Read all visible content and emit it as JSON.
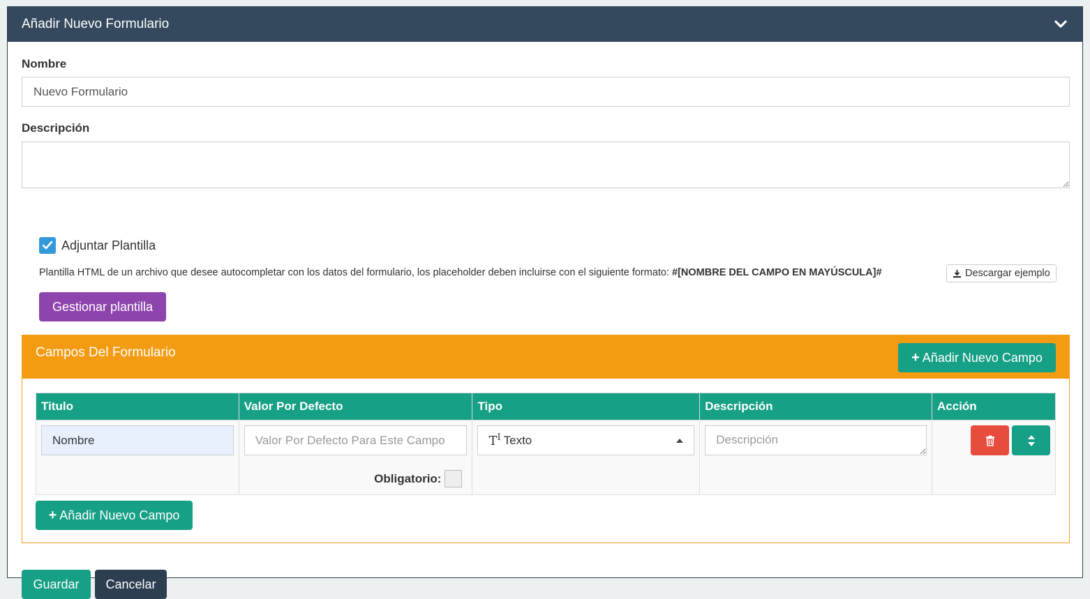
{
  "header": {
    "title": "Añadir Nuevo Formulario",
    "collapse_icon": "chevron-down-icon"
  },
  "form": {
    "name_label": "Nombre",
    "name_value": "Nuevo Formulario",
    "description_label": "Descripción",
    "description_value": "",
    "attach_template_label": "Adjuntar Plantilla",
    "attach_template_checked": true,
    "help_text": "Plantilla HTML de un archivo que desee autocompletar con los datos del formulario, los placeholder deben incluirse con el siguiente formato: ",
    "help_format": "#[NOMBRE DEL CAMPO EN MAYÚSCULA]#",
    "download_example_label": "Descargar ejemplo",
    "manage_template_label": "Gestionar plantilla"
  },
  "fields_panel": {
    "title": "Campos Del Formulario",
    "add_field_label": "Añadir Nuevo Campo",
    "columns": [
      "Titulo",
      "Valor Por Defecto",
      "Tipo",
      "Descripción",
      "Acción"
    ],
    "rows": [
      {
        "title": "Nombre",
        "default_placeholder": "Valor Por Defecto Para Este Campo",
        "required_label": "Obligatorio:",
        "required_checked": false,
        "type_icon": "text-type-icon",
        "type_label": "Texto",
        "description_placeholder": "Descripción"
      }
    ],
    "add_field_bottom_label": "Añadir Nuevo Campo"
  },
  "footer": {
    "save_label": "Guardar",
    "cancel_label": "Cancelar"
  },
  "colors": {
    "header": "#34495e",
    "orange": "#f39c12",
    "teal": "#16a085",
    "purple": "#8e44ad",
    "red": "#e74c3c",
    "checkbox": "#3498db",
    "dark": "#2c3e50"
  }
}
